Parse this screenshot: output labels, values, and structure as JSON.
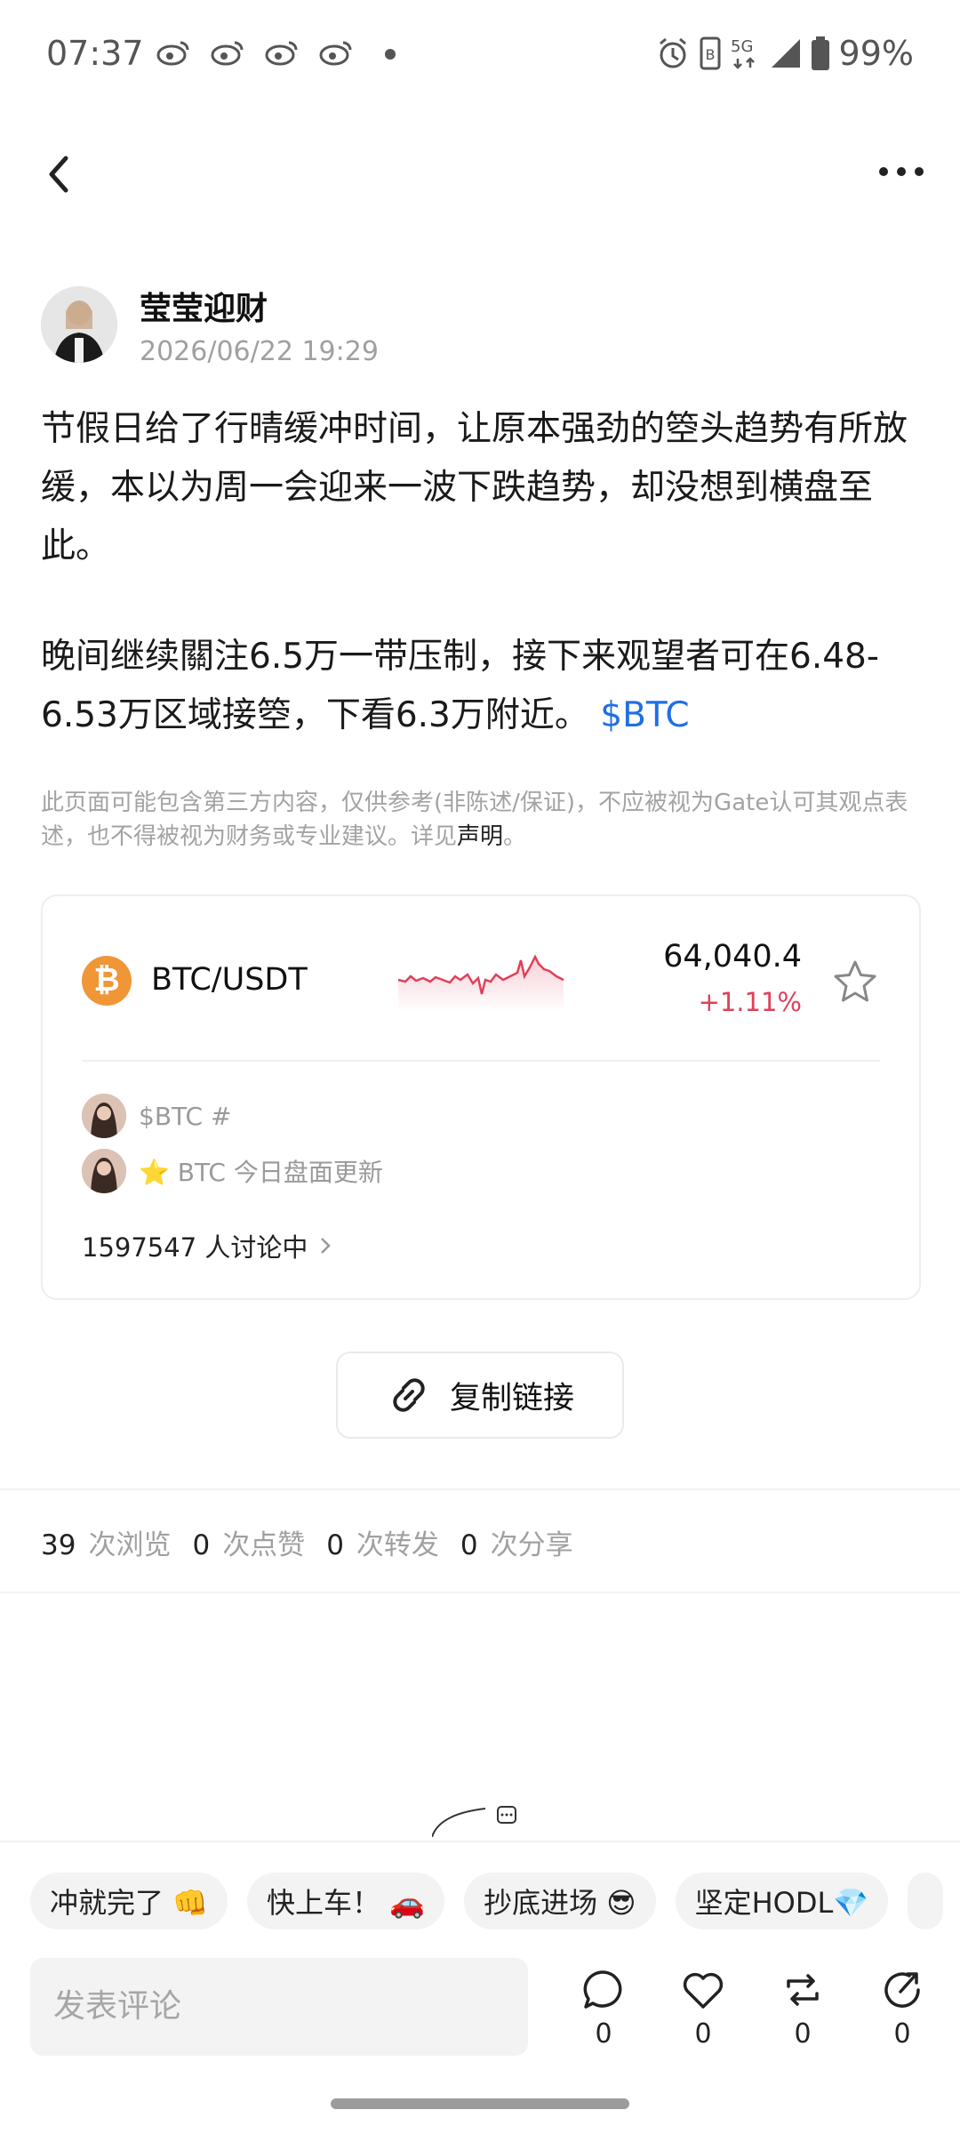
{
  "status_bar": {
    "time": "07:37",
    "network": "5G",
    "battery": "99%"
  },
  "author": {
    "name": "莹莹迎财",
    "timestamp": "2026/06/22 19:29"
  },
  "post": {
    "paragraph1": "节假日给了行晴缓冲时间，让原本强劲的箜头趋势有所放缓，本以为周一会迎来一波下跌趋势，却没想到横盘至此。",
    "paragraph2": "晚间继续關注6.5万一带压制，接下来观望者可在6.48-6.53万区域接箜，下看6.3万附近。",
    "tag": "$BTC"
  },
  "disclaimer": {
    "text": "此页面可能包含第三方内容，仅供参考(非陈述/保证)，不应被视为Gate认可其观点表述，也不得被视为财务或专业建议。详见",
    "link": "声明",
    "end": "。"
  },
  "market_card": {
    "pair": "BTC/USDT",
    "price": "64,040.4",
    "change": "+1.11%",
    "topics": [
      {
        "text": "$BTC #"
      },
      {
        "text": "⭐ BTC 今日盘面更新"
      }
    ],
    "discussing": "1597547 人讨论中"
  },
  "copy_link": {
    "label": "复制链接"
  },
  "stats": {
    "views": "39",
    "views_label": "次浏览",
    "likes": "0",
    "likes_label": "次点赞",
    "reposts": "0",
    "reposts_label": "次转发",
    "shares": "0",
    "shares_label": "次分享"
  },
  "quick_replies": [
    "冲就完了 👊",
    "快上车！ 🚗",
    "抄底进场 😎",
    "坚定HODL💎"
  ],
  "comment": {
    "placeholder": "发表评论"
  },
  "actions": {
    "comment_count": "0",
    "like_count": "0",
    "repost_count": "0",
    "share_count": "0"
  },
  "colors": {
    "accent_link": "#1f6fe5",
    "up_red": "#e0405a",
    "btc_orange": "#f09637"
  }
}
